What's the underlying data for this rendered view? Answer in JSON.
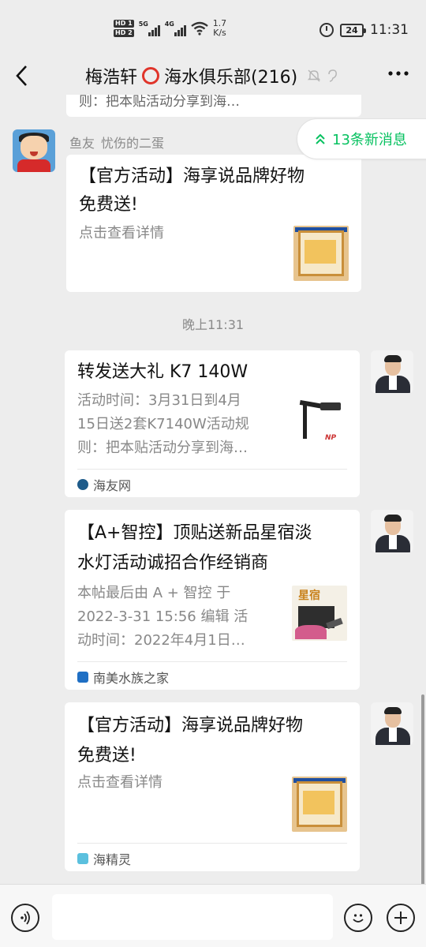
{
  "status_bar": {
    "hd1": "HD 1",
    "hd2": "HD 2",
    "net1": "5G",
    "net2": "4G",
    "speed_value": "1.7",
    "speed_unit": "K/s",
    "battery": "24",
    "time": "11:31"
  },
  "nav": {
    "title_pre": "梅浩轩",
    "title_post": "海水俱乐部(216)",
    "back_glyph": "〈",
    "more_glyph": "•••"
  },
  "chat": {
    "prev_fragment": "则：把本贴活动分享到海…",
    "new_messages": "13条新消息",
    "sender": {
      "label": "鱼友",
      "name": "忧伤的二蛋"
    },
    "card1": {
      "title_line1": "【官方活动】海享说品牌好物",
      "title_line2": "免费送!",
      "desc": "点击查看详情"
    },
    "timestamp": "晚上11:31",
    "card2": {
      "title": "转发送大礼 K7 140W",
      "desc_line1": "活动时间：3月31日到4月",
      "desc_line2": "15日送2套K7140W活动规",
      "desc_line3": "则：把本贴活动分享到海…",
      "thumb_text": "NP",
      "source": "海友网"
    },
    "card3": {
      "title_line1": "【A+智控】顶贴送新品星宿淡",
      "title_line2": "水灯活动诚招合作经销商",
      "desc_line1": " 本帖最后由 A + 智控 于",
      "desc_line2": "2022-3-31 15:56 编辑 活",
      "desc_line3": "动时间：2022年4月1日…",
      "thumb_text": "星宿",
      "source": "南美水族之家"
    },
    "card4": {
      "title_line1": "【官方活动】海享说品牌好物",
      "title_line2": "免费送!",
      "desc": "点击查看详情",
      "source": "海精灵"
    }
  },
  "input_bar": {
    "voice_glyph": "◉",
    "emoji_glyph": "☺",
    "plus_glyph": "+",
    "text_value": ""
  },
  "colors": {
    "accent_green": "#07c160",
    "background": "#ededed",
    "ring_red": "#e0342a"
  }
}
